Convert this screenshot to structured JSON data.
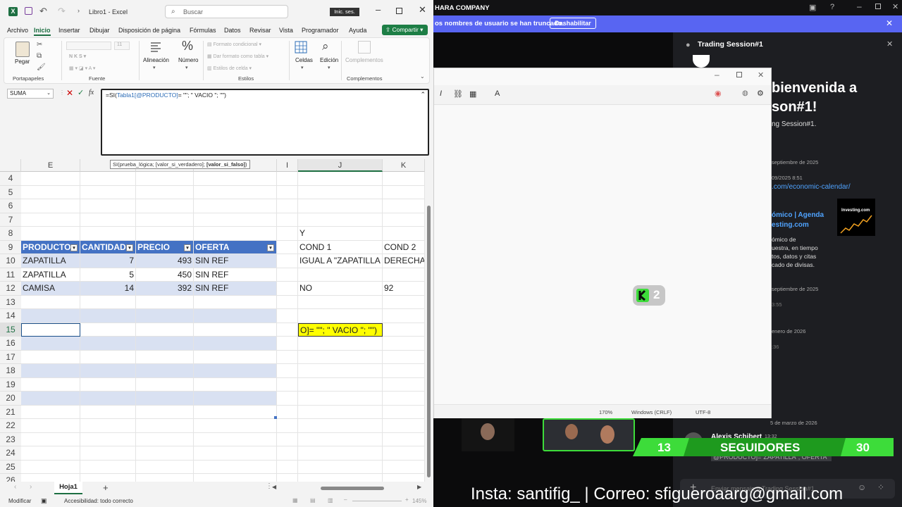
{
  "excel": {
    "title": "Libro1 - Excel",
    "search_placeholder": "Buscar",
    "signin": "Inic. ses.",
    "menu": [
      "Archivo",
      "Inicio",
      "Insertar",
      "Dibujar",
      "Disposición de página",
      "Fórmulas",
      "Datos",
      "Revisar",
      "Vista",
      "Programador",
      "Ayuda"
    ],
    "share": "Compartir",
    "ribbon": {
      "paste": "Pegar",
      "clipboard": "Portapapeles",
      "font_group": "Fuente",
      "font_size": "11",
      "alignment": "Alineación",
      "number": "Número",
      "cond_format": "Formato condicional",
      "table_format": "Dar formato como tabla",
      "cell_styles": "Estilos de celda",
      "styles": "Estilos",
      "cells": "Celdas",
      "editing": "Edición",
      "addins": "Complementos",
      "addins_group": "Complementos"
    },
    "namebox": "SUMA",
    "formula": "=SI(Tabla1[@PRODUCTO]= \"\"; \" VACIO \"; \"\")",
    "formula_parts": {
      "a": "=SI(",
      "b": "Tabla1[@PRODUCTO]",
      "c": "= \"\"; \" VACIO \"; \"\")"
    },
    "tooltip": {
      "a": "SI(prueba_lógica; [valor_si_verdadero]; ",
      "b": "[valor_si_falso]",
      "c": ")"
    },
    "columns": {
      "e": "E",
      "i": "I",
      "j": "J",
      "k": "K"
    },
    "rows": [
      "4",
      "5",
      "6",
      "7",
      "8",
      "9",
      "10",
      "11",
      "12",
      "13",
      "14",
      "15",
      "16",
      "17",
      "18",
      "19",
      "20",
      "21",
      "22",
      "23",
      "24",
      "25",
      "26"
    ],
    "table": {
      "headers": [
        "PRODUCTO",
        "CANTIDAD",
        "PRECIO",
        "OFERTA"
      ],
      "rows": [
        [
          "ZAPATILLA",
          "7",
          "493",
          "SIN REF"
        ],
        [
          "ZAPATILLA",
          "5",
          "450",
          "SIN REF"
        ],
        [
          "CAMISA",
          "14",
          "392",
          "SIN REF"
        ]
      ]
    },
    "j8": "Y",
    "j9": "COND 1",
    "k9": "COND 2",
    "j10": "IGUAL A \"ZAPATILLA",
    "k10": "DERECHA",
    "j12": "NO",
    "k12": "92",
    "j15": "O]= \"\"; \" VACIO \"; \"\")",
    "sheet_tab": "Hoja1",
    "status_mode": "Modificar",
    "status_access": "Accesibilidad: todo correcto",
    "zoom": "145%"
  },
  "right": {
    "company": "HARA COMPANY",
    "banner": "os nombres de usuario se han truncado.",
    "disable": "Deshabilitar",
    "channel": "Trading Session#1",
    "welcome_1": "bienvenida a",
    "welcome_2": "son#1!",
    "welcome_3": "ng Session#1.",
    "date1": "septiembre de 2025",
    "time1": "09/2025 8:51",
    "link": ".com/economic-calendar/",
    "embed_title_1": "ómico | Agenda",
    "embed_title_2": "esting.com",
    "embed_desc": [
      "ómico de",
      "uestra, en tiempo",
      "tos, datos y citas",
      "cado de divisas."
    ],
    "investing": "Investing.com",
    "date2": "septiembre de 2025",
    "time2": "3:55",
    "date3": "enero de 2026",
    "time3": ":36",
    "date4": "5 de marzo de 2026",
    "author": "Alexis Schibert",
    "author_time": "13:32",
    "msg_tail": "@PRODUCTO]=\"ZAPATILLA\"; OFERTA\"",
    "input_placeholder": "Enviar mensaje a Trading Session#1",
    "notepad_zoom": "170%",
    "notepad_eol": "Windows (CRLF)",
    "notepad_enc": "UTF-8",
    "badge_count": "2",
    "followers_left": "13",
    "followers_label": "SEGUIDORES",
    "followers_right": "30",
    "insta": "Insta: santifig_ | Correo: sfigueroaarg@gmail.com"
  },
  "colors": {
    "table_header": "#4472c4",
    "band": "#d9e1f2",
    "banner": "#5865f2",
    "green": "#3ddc3a",
    "highlight": "#ffff00"
  }
}
